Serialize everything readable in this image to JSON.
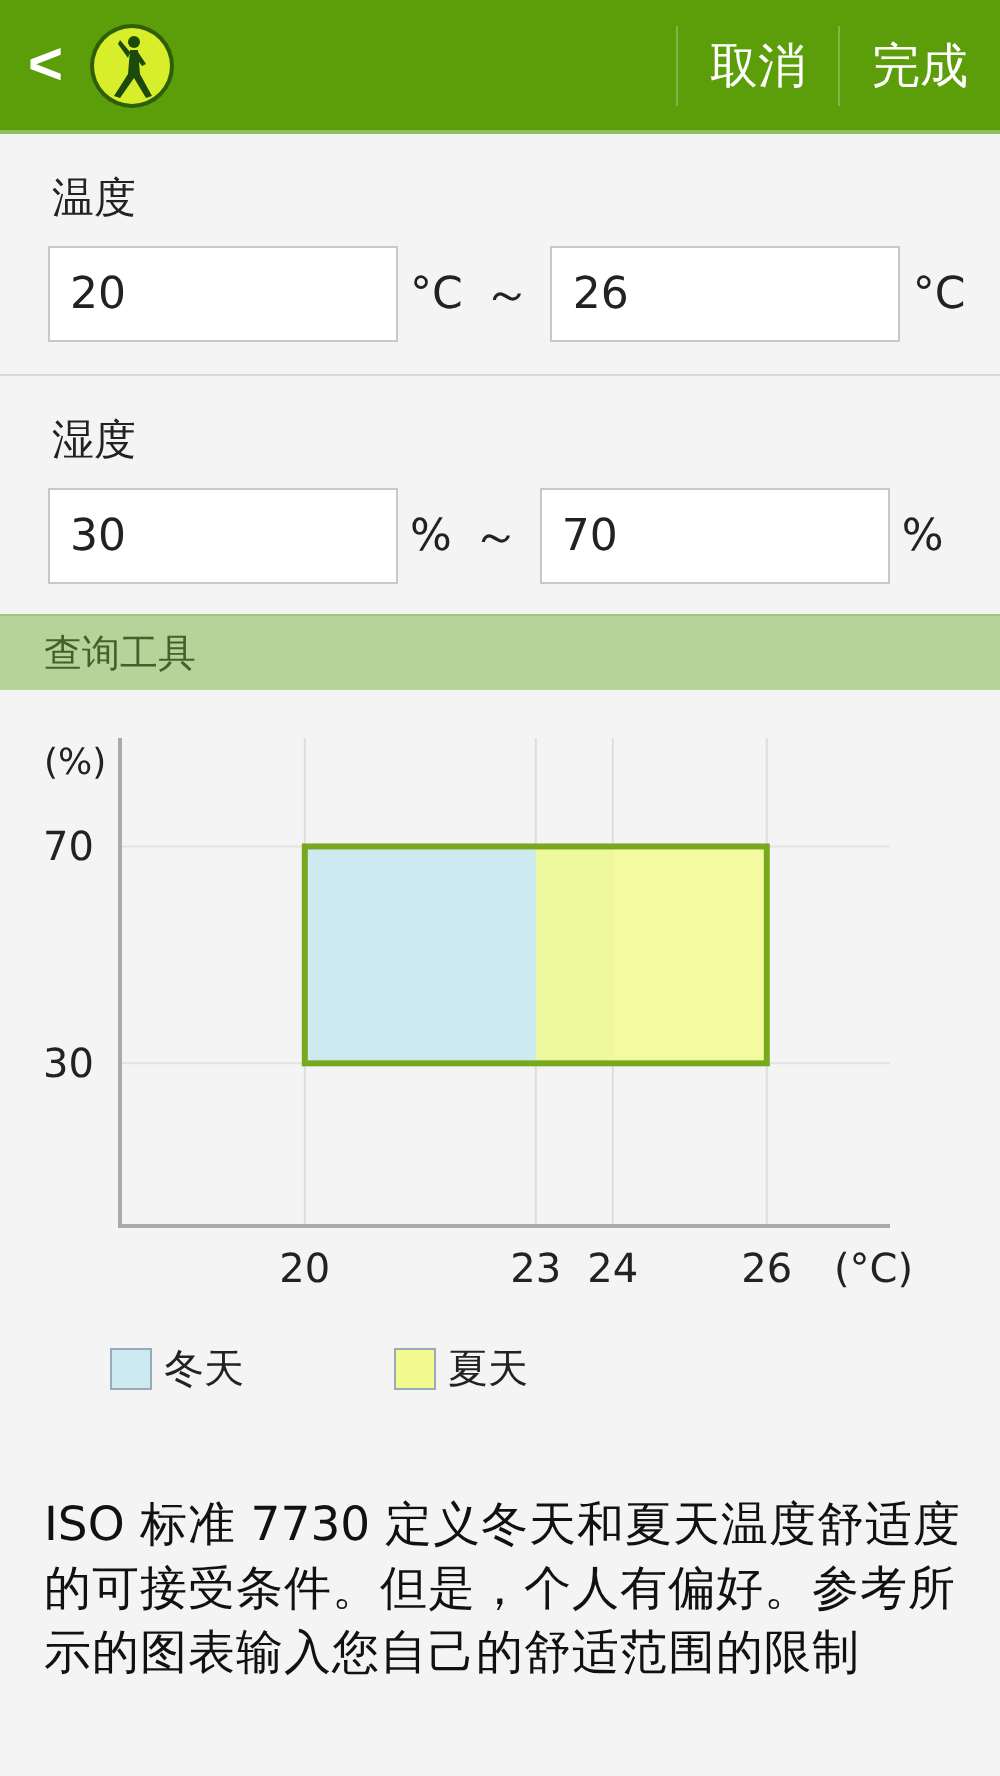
{
  "header": {
    "back": "<",
    "cancel": "取消",
    "done": "完成"
  },
  "temperature": {
    "label": "温度",
    "min": "20",
    "min_unit": "°C",
    "separator": "～",
    "max": "26",
    "max_unit": "°C"
  },
  "humidity": {
    "label": "湿度",
    "min": "30",
    "min_unit": "%",
    "separator": "～",
    "max": "70",
    "max_unit": "%"
  },
  "section": {
    "title": "查询工具"
  },
  "chart_data": {
    "type": "area",
    "grid": true,
    "xlabel": "(°C)",
    "ylabel": "(%)",
    "x": [
      20,
      23,
      24,
      26
    ],
    "xlim": [
      17.6,
      27.6
    ],
    "ylim": [
      0,
      90
    ],
    "xticks": [
      20,
      23,
      24,
      26
    ],
    "yticks": [
      30,
      70
    ],
    "series": [
      {
        "name": "冬天",
        "color": "#cdeaf0",
        "values": [
          70,
          70,
          70,
          null
        ]
      },
      {
        "name": "夏天",
        "color": "#f3fa90",
        "values": [
          null,
          70,
          70,
          70
        ]
      }
    ]
  },
  "note": "ISO 标准 7730 定义冬天和夏天温度舒适度的可接受条件。但是，个人有偏好。参考所示的图表输入您自己的舒适范围的限制"
}
